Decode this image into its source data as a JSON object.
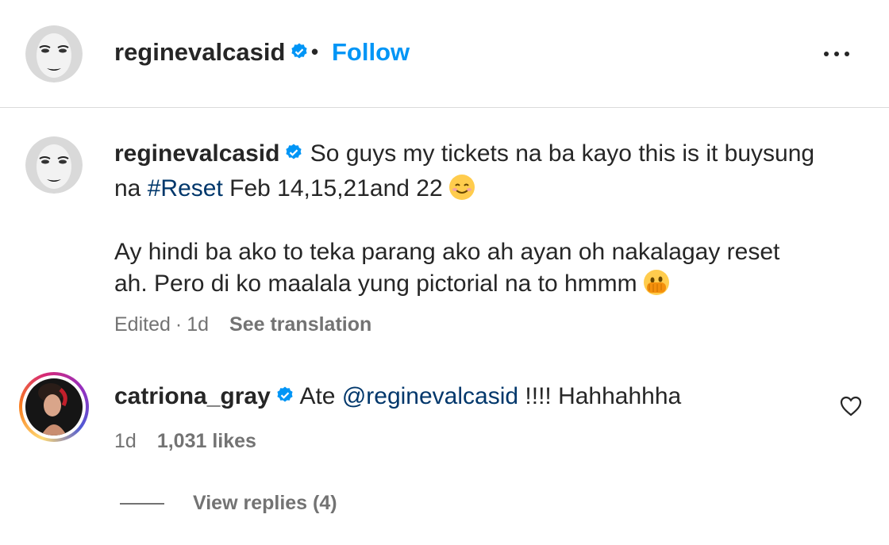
{
  "header": {
    "username": "reginevalcasid",
    "dot": "•",
    "follow_label": "Follow"
  },
  "caption": {
    "username": "reginevalcasid",
    "line1_text": "So guys my tickets na ba kayo this is it buysung",
    "line2_prefix": "na ",
    "hashtag": "#Reset",
    "line2_rest": " Feb 14,15,21and 22",
    "line3": "Ay hindi ba ako to teka parang ako ah ayan oh nakalagay reset",
    "line4": "ah. Pero di ko maalala yung pictorial na to hmmm",
    "edited": "Edited",
    "separator": "·",
    "time": "1d",
    "see_translation": "See translation"
  },
  "comment": {
    "username": "catriona_gray",
    "prefix": "Ate ",
    "mention": "@reginevalcasid",
    "suffix": " !!!! Hahhahhha",
    "time": "1d",
    "likes": "1,031 likes",
    "view_replies": "View replies (4)"
  },
  "icons": {
    "verified": "verified-badge-icon",
    "more": "more-options-icon",
    "heart": "heart-icon",
    "smile": "smiling-face-emoji",
    "peek": "face-with-peeking-eye-emoji"
  },
  "colors": {
    "accent": "#0095f6",
    "link": "#00376b",
    "secondary_text": "#737373",
    "divider": "#dbdbdb"
  }
}
